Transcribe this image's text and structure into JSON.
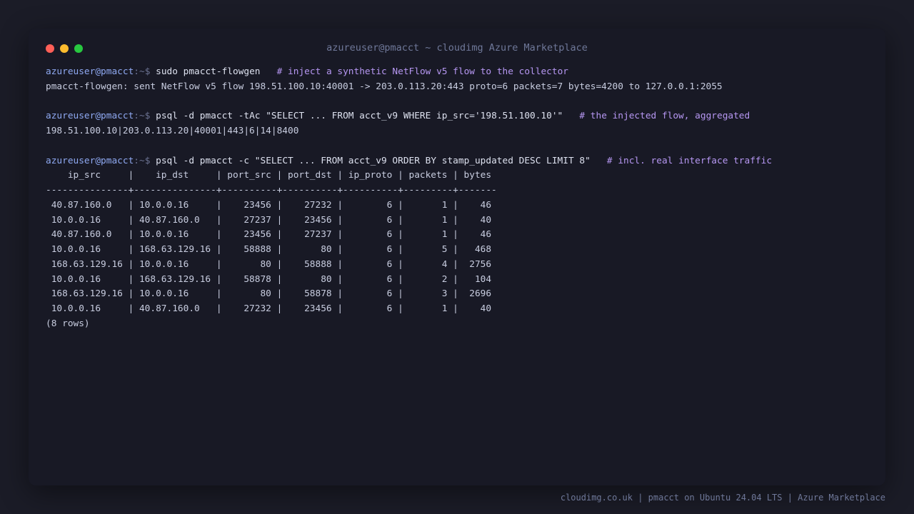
{
  "window": {
    "title": "azureuser@pmacct ~ cloudimg Azure Marketplace",
    "controls": [
      "close",
      "minimize",
      "maximize"
    ]
  },
  "prompt": {
    "user_host": "azureuser@pmacct",
    "path_symbol": ":~$"
  },
  "session": [
    {
      "command": "sudo pmacct-flowgen",
      "comment": "# inject a synthetic NetFlow v5 flow to the collector",
      "output": [
        "pmacct-flowgen: sent NetFlow v5 flow 198.51.100.10:40001 -> 203.0.113.20:443 proto=6 packets=7 bytes=4200 to 127.0.0.1:2055"
      ]
    },
    {
      "command": "psql -d pmacct -tAc \"SELECT ... FROM acct_v9 WHERE ip_src='198.51.100.10'\"",
      "comment": "# the injected flow, aggregated",
      "output": [
        "198.51.100.10|203.0.113.20|40001|443|6|14|8400"
      ]
    },
    {
      "command": "psql -d pmacct -c \"SELECT ... FROM acct_v9 ORDER BY stamp_updated DESC LIMIT 8\"",
      "comment": "# incl. real interface traffic",
      "output": [
        "    ip_src     |    ip_dst     | port_src | port_dst | ip_proto | packets | bytes",
        "---------------+---------------+----------+----------+----------+---------+-------",
        " 40.87.160.0   | 10.0.0.16     |    23456 |    27232 |        6 |       1 |    46",
        " 10.0.0.16     | 40.87.160.0   |    27237 |    23456 |        6 |       1 |    40",
        " 40.87.160.0   | 10.0.0.16     |    23456 |    27237 |        6 |       1 |    46",
        " 10.0.0.16     | 168.63.129.16 |    58888 |       80 |        6 |       5 |   468",
        " 168.63.129.16 | 10.0.0.16     |       80 |    58888 |        6 |       4 |  2756",
        " 10.0.0.16     | 168.63.129.16 |    58878 |       80 |        6 |       2 |   104",
        " 168.63.129.16 | 10.0.0.16     |       80 |    58878 |        6 |       3 |  2696",
        " 10.0.0.16     | 40.87.160.0   |    27232 |    23456 |        6 |       1 |    40",
        "(8 rows)"
      ]
    }
  ],
  "footer": "cloudimg.co.uk | pmacct on Ubuntu 24.04 LTS | Azure Marketplace",
  "colors": {
    "background": "#1b1c27",
    "terminal": "#181925",
    "prompt_user": "#8fa9f2",
    "comment": "#b697f2",
    "text": "#c8cde0"
  }
}
